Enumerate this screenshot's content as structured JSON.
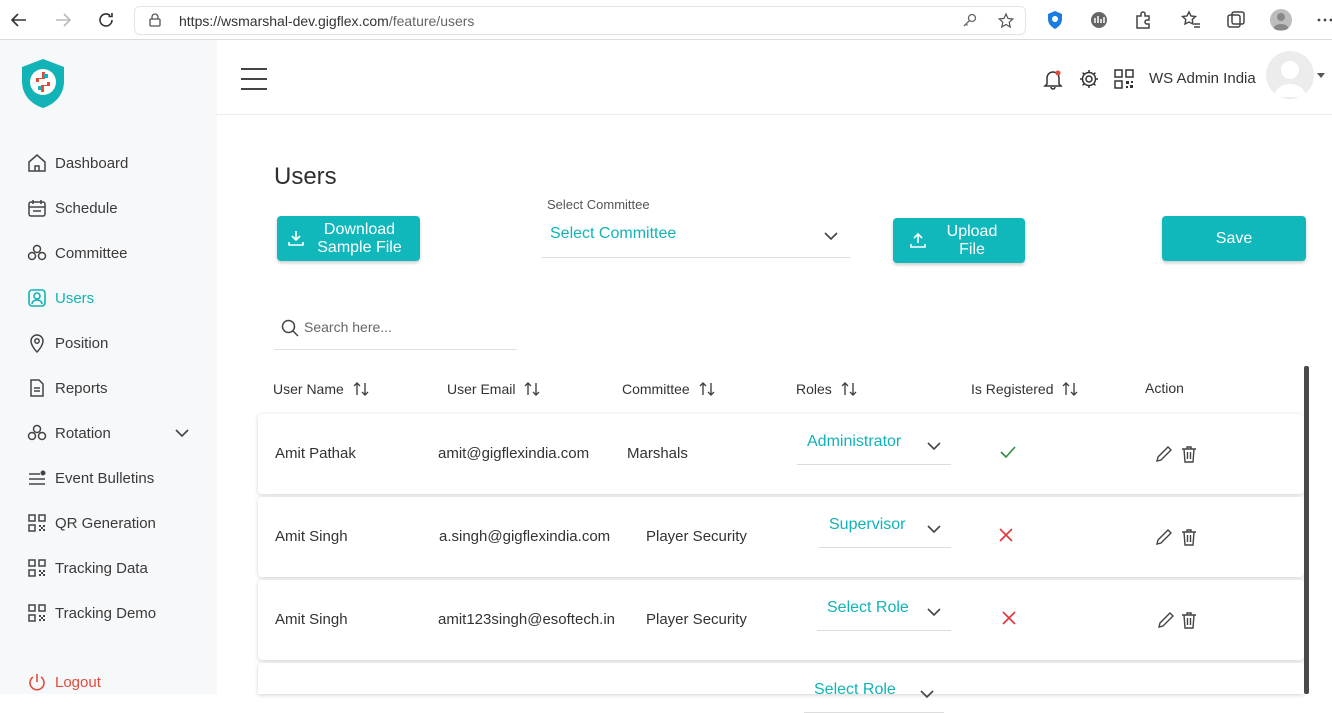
{
  "browser": {
    "url_host": "https://wsmarshal-dev.gigflex.com",
    "url_path": "/feature/users"
  },
  "sidebar": {
    "items": [
      {
        "label": "Dashboard",
        "icon": "home-icon"
      },
      {
        "label": "Schedule",
        "icon": "calendar-icon"
      },
      {
        "label": "Committee",
        "icon": "committee-icon"
      },
      {
        "label": "Users",
        "icon": "user-icon",
        "active": true
      },
      {
        "label": "Position",
        "icon": "location-pin-icon"
      },
      {
        "label": "Reports",
        "icon": "document-icon"
      },
      {
        "label": "Rotation",
        "icon": "rotation-icon"
      },
      {
        "label": "Event Bulletins",
        "icon": "bulletin-icon"
      },
      {
        "label": "QR Generation",
        "icon": "qr-icon"
      },
      {
        "label": "Tracking Data",
        "icon": "qr-icon"
      },
      {
        "label": "Tracking Demo",
        "icon": "qr-icon"
      }
    ],
    "logout_label": "Logout"
  },
  "header": {
    "user_name": "WS Admin India"
  },
  "page": {
    "title": "Users",
    "download_label": "Download Sample File",
    "upload_label": "Upload File",
    "save_label": "Save",
    "committee_label": "Select Committee",
    "committee_value": "Select Committee",
    "search_placeholder": "Search here..."
  },
  "table": {
    "columns": [
      "User Name",
      "User Email",
      "Committee",
      "Roles",
      "Is Registered",
      "Action"
    ],
    "rows": [
      {
        "name": "Amit Pathak",
        "email": "amit@gigflexindia.com",
        "committee": "Marshals",
        "role": "Administrator",
        "registered": true
      },
      {
        "name": "Amit Singh",
        "email": "a.singh@gigflexindia.com",
        "committee": "Player Security",
        "role": "Supervisor",
        "registered": false
      },
      {
        "name": "Amit Singh",
        "email": "amit123singh@esoftech.in",
        "committee": "Player Security",
        "role": "Select Role",
        "registered": false
      },
      {
        "name": "",
        "email": "",
        "committee": "",
        "role": "Select Role",
        "registered": null
      }
    ]
  },
  "colors": {
    "accent": "#11b8bb",
    "check": "#2e8b3e",
    "cross": "#e0353a"
  }
}
